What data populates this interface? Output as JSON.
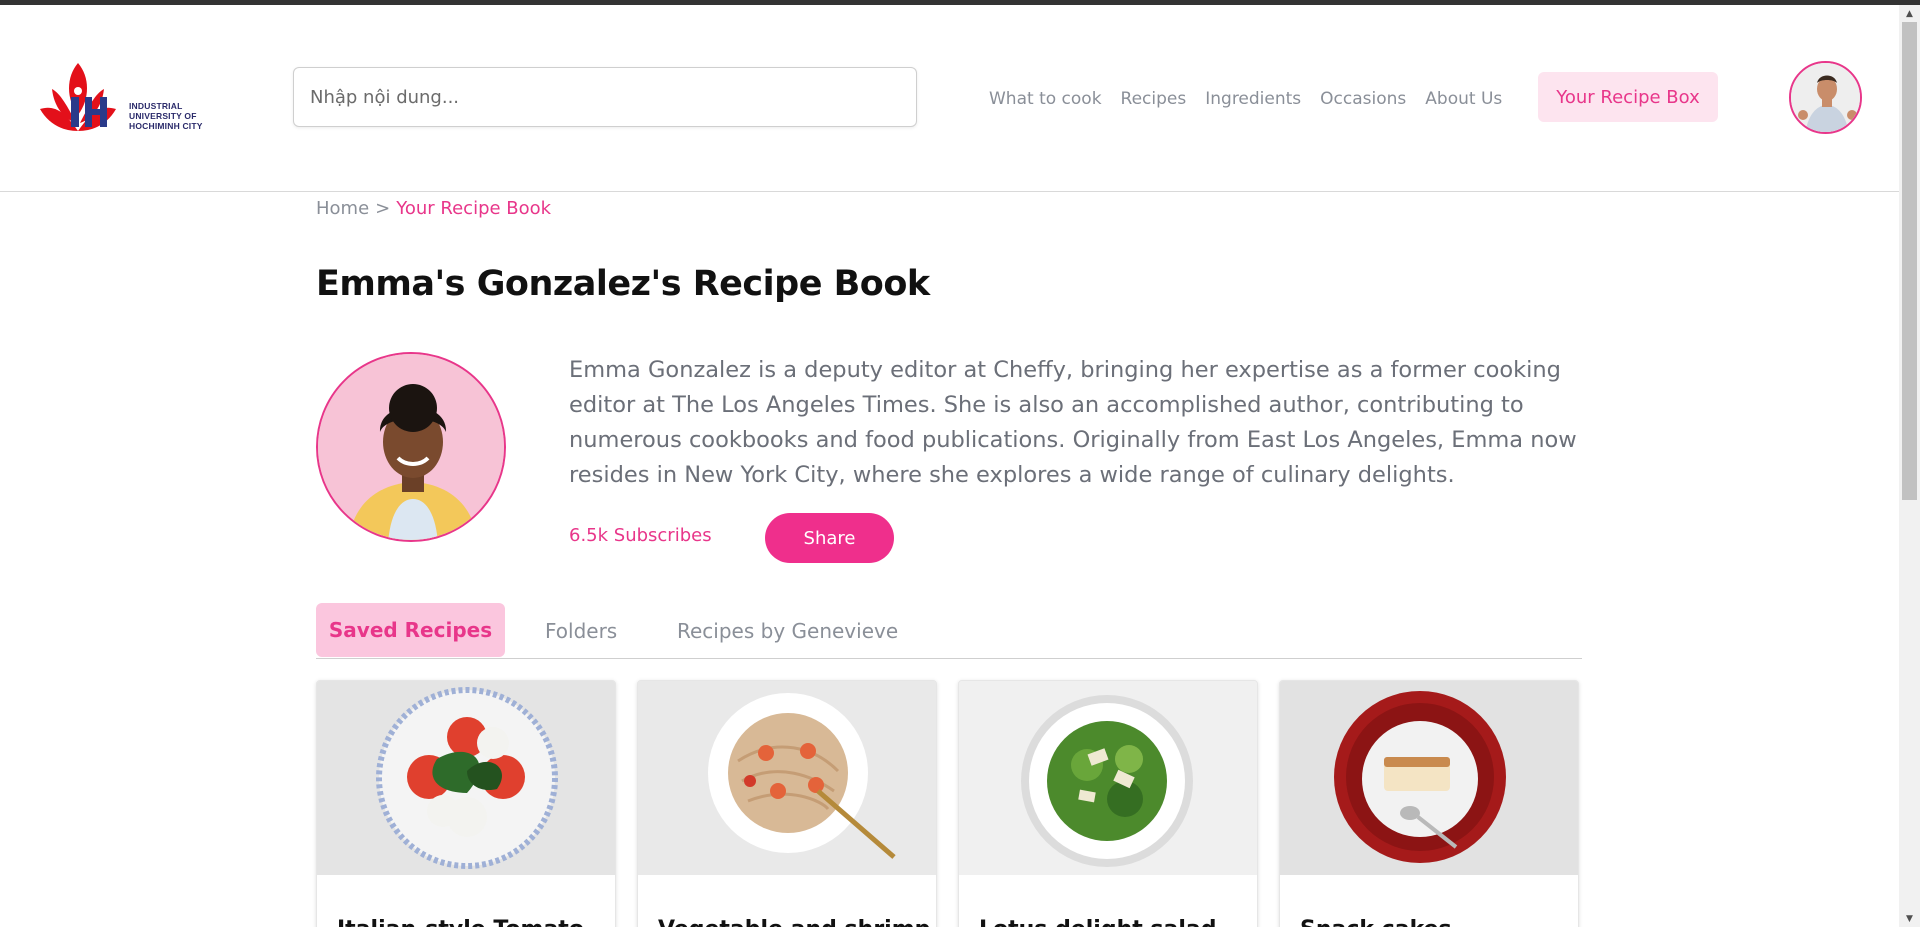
{
  "header": {
    "logo_text": [
      "INDUSTRIAL",
      "UNIVERSITY OF",
      "HOCHIMINH CITY"
    ],
    "search_placeholder": "Nhập nội dung...",
    "nav": [
      "What to cook",
      "Recipes",
      "Ingredients",
      "Occasions",
      "About Us"
    ],
    "recipe_box_label": "Your Recipe Box",
    "colors": {
      "accent": "#e8368a",
      "accent_light": "#fde4ef",
      "nav": "#8a8f98"
    }
  },
  "breadcrumb": {
    "home": "Home",
    "separator": ">",
    "current": "Your Recipe Book"
  },
  "page": {
    "title": "Emma's Gonzalez's Recipe Book",
    "bio": "Emma Gonzalez is a deputy editor at Cheffy, bringing her expertise as a former cooking editor at The Los Angeles Times. She is also an accomplished author, contributing to numerous cookbooks and food publications. Originally from East Los Angeles, Emma now resides in New York City, where she explores a wide range of culinary delights.",
    "subscribes": "6.5k Subscribes",
    "share_label": "Share"
  },
  "tabs": [
    {
      "label": "Saved Recipes",
      "active": true
    },
    {
      "label": "Folders",
      "active": false
    },
    {
      "label": "Recipes by Genevieve",
      "active": false
    }
  ],
  "cards": [
    {
      "title": "Italian-style Tomato",
      "image": "caprese salad plate"
    },
    {
      "title": "Vegetable and shrimp",
      "image": "shrimp spaghetti plate"
    },
    {
      "title": "Lotus delight salad",
      "image": "green salad plate"
    },
    {
      "title": "Snack cakes",
      "image": "cake slice on red plate"
    }
  ]
}
